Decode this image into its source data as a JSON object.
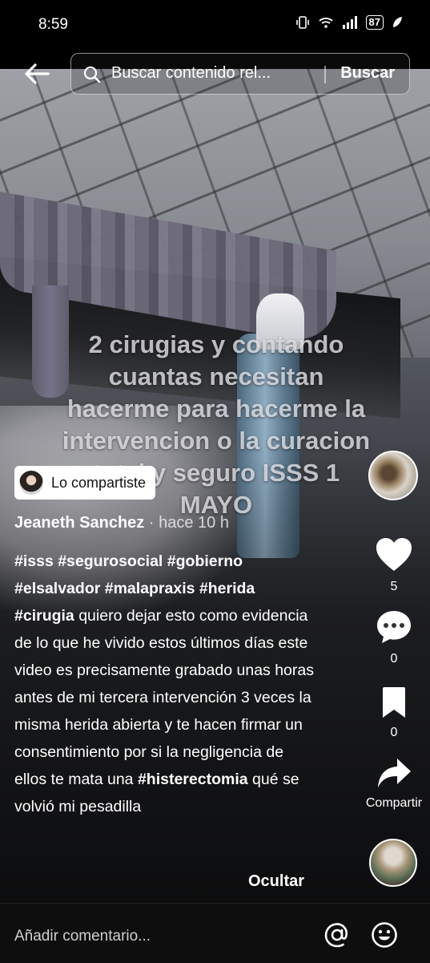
{
  "status_bar": {
    "time": "8:59",
    "battery": "87",
    "icons": [
      "vibrate-icon",
      "wifi-icon",
      "signal-icon",
      "battery-icon",
      "leaf-icon"
    ]
  },
  "search": {
    "query": "Buscar contenido rel...",
    "button": "Buscar"
  },
  "video_overlay": {
    "lines": [
      "2 cirugias y contando",
      "cuantas necesitan",
      "hacerme para hacerme la",
      "intervencion o la curacion",
      "total y seguro ISSS 1",
      "MAYO"
    ]
  },
  "shared_chip": {
    "label": "Lo compartiste"
  },
  "author": {
    "name": "Jeaneth Sanchez",
    "separator": "·",
    "time": "hace 10 h"
  },
  "description": {
    "tags_line1": "#isss #segurosocial #gobierno",
    "tags_line2": "#elsalvador #malapraxis #herida",
    "tag3": "#cirugia",
    "text1": " quiero dejar esto como evidencia de lo que he vivido estos últimos días este video es precisamente grabado unas horas antes de mi tercera intervención 3 veces la misma herida abierta y te hacen firmar un consentimiento por si la negligencia de ellos te mata una  ",
    "tag4": "#histerectomia",
    "text2": " qué se volvió mi pesadilla"
  },
  "hide_label": "Ocultar",
  "actions": {
    "likes": "5",
    "comments": "0",
    "saves": "0",
    "share_label": "Compartir"
  },
  "comment_bar": {
    "placeholder": "Añadir comentario..."
  }
}
